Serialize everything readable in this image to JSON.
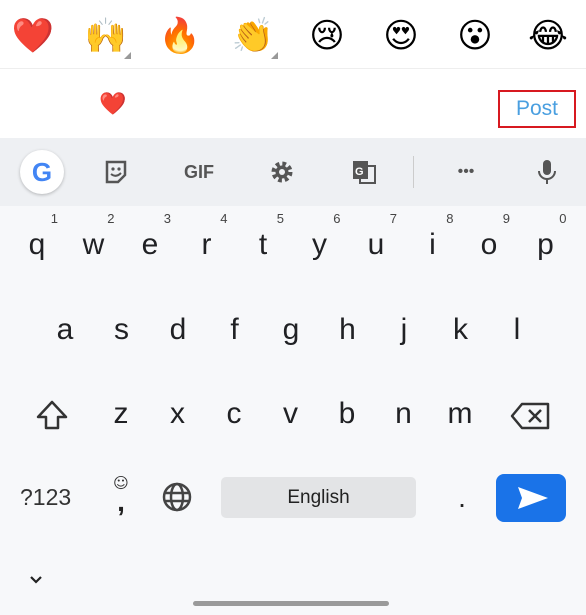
{
  "reactions": [
    {
      "emoji": "❤️",
      "name": "red-heart"
    },
    {
      "emoji": "🙌",
      "name": "raising-hands",
      "has_variants": true
    },
    {
      "emoji": "🔥",
      "name": "fire"
    },
    {
      "emoji": "👏",
      "name": "clapping-hands",
      "has_variants": true
    },
    {
      "emoji": "😢",
      "name": "crying-face"
    },
    {
      "emoji": "😍",
      "name": "heart-eyes"
    },
    {
      "emoji": "😮",
      "name": "surprised-face"
    },
    {
      "emoji": "😂",
      "name": "tears-of-joy"
    }
  ],
  "comment": {
    "value": "❤️",
    "post_label": "Post",
    "highlight_color": "#d71920",
    "post_color": "#4a9fe0"
  },
  "toolbar": {
    "google": "G",
    "gif": "GIF",
    "more": "•••",
    "icons": [
      "google-icon",
      "sticker-icon",
      "gif-icon",
      "gear-icon",
      "translate-icon",
      "more-icon",
      "microphone-icon"
    ]
  },
  "keyboard": {
    "row1": [
      "q",
      "w",
      "e",
      "r",
      "t",
      "y",
      "u",
      "i",
      "o",
      "p"
    ],
    "row1_hints": [
      "1",
      "2",
      "3",
      "4",
      "5",
      "6",
      "7",
      "8",
      "9",
      "0"
    ],
    "row2": [
      "a",
      "s",
      "d",
      "f",
      "g",
      "h",
      "j",
      "k",
      "l"
    ],
    "row3": [
      "z",
      "x",
      "c",
      "v",
      "b",
      "n",
      "m"
    ],
    "symbols_label": "?123",
    "comma": ",",
    "emoji_hint": "☺",
    "space_label": "English",
    "period": ".",
    "accent_color": "#1a73e8"
  }
}
